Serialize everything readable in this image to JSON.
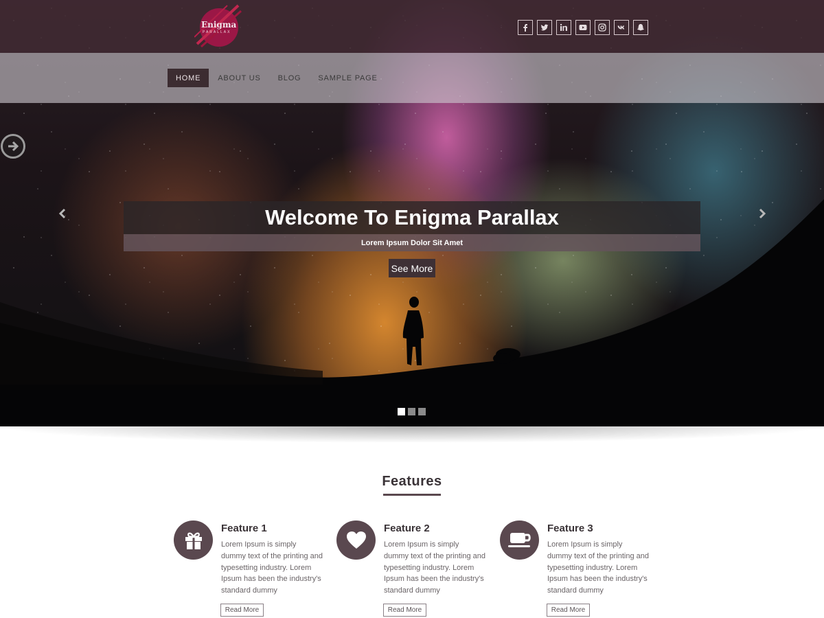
{
  "site": {
    "logo_title": "Enigma",
    "logo_subtitle": "PARALLAX"
  },
  "social_icons": [
    "facebook-icon",
    "twitter-icon",
    "linkedin-icon",
    "youtube-icon",
    "instagram-icon",
    "vk-icon",
    "snapchat-icon"
  ],
  "nav": {
    "items": [
      {
        "label": "HOME",
        "active": true
      },
      {
        "label": "ABOUT US",
        "active": false
      },
      {
        "label": "BLOG",
        "active": false
      },
      {
        "label": "SAMPLE PAGE",
        "active": false
      }
    ]
  },
  "hero": {
    "title": "Welcome To Enigma Parallax",
    "subtitle": "Lorem Ipsum Dolor Sit Amet",
    "button_label": "See More",
    "slide_count": 3,
    "active_slide": 1
  },
  "features": {
    "heading": "Features",
    "items": [
      {
        "title": "Feature 1",
        "icon": "gift-icon",
        "text": "Lorem Ipsum is simply dummy text of the printing and typesetting industry. Lorem Ipsum has been the industry's standard dummy",
        "button_label": "Read More"
      },
      {
        "title": "Feature 2",
        "icon": "heart-icon",
        "text": "Lorem Ipsum is simply dummy text of the printing and typesetting industry. Lorem Ipsum has been the industry's standard dummy",
        "button_label": "Read More"
      },
      {
        "title": "Feature 3",
        "icon": "coffee-cup-icon",
        "text": "Lorem Ipsum is simply dummy text of the printing and typesetting industry. Lorem Ipsum has been the industry's standard dummy",
        "button_label": "Read More"
      }
    ]
  },
  "colors": {
    "brand": "#5a484f",
    "nav_active": "#3c2c31",
    "header_bg": "#442c34"
  }
}
